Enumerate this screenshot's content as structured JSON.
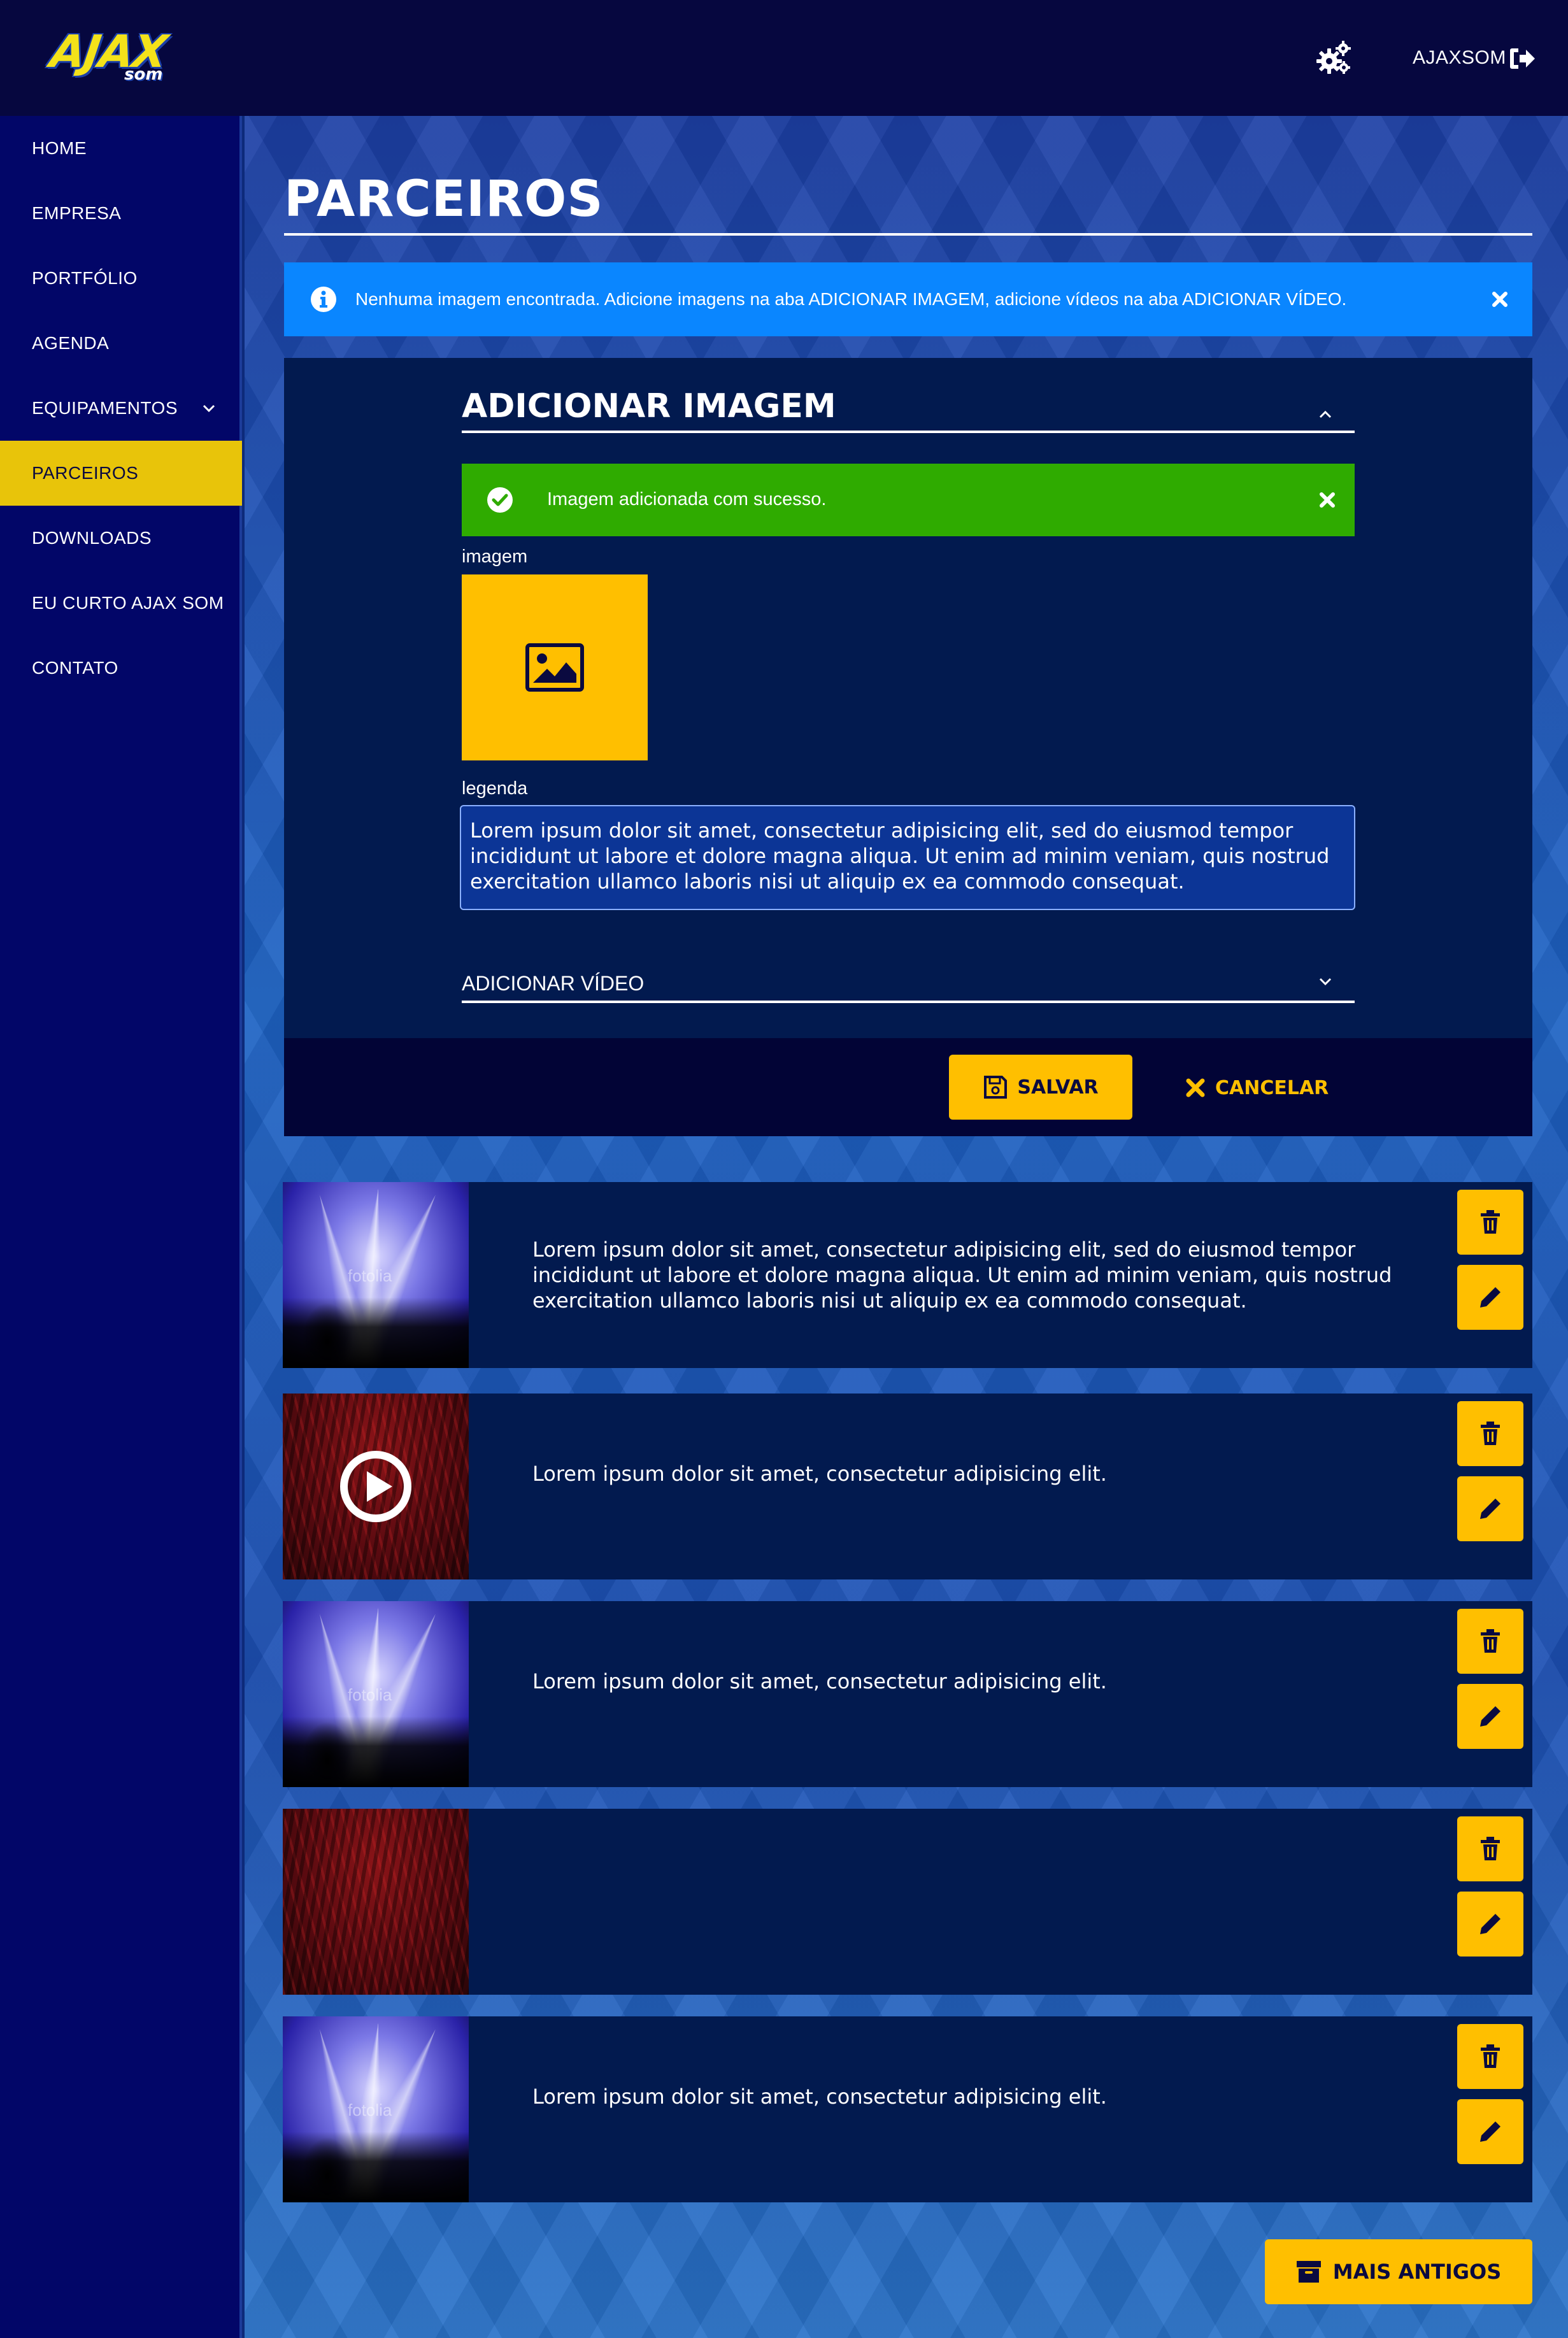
{
  "header": {
    "logo_text": "AJAX",
    "logo_subtext": "SOM",
    "settings_icon": "gears-icon",
    "user_name": "AJAXSOM",
    "logout_icon": "sign-out-icon"
  },
  "sidebar": {
    "items": [
      {
        "label": "HOME"
      },
      {
        "label": "EMPRESA"
      },
      {
        "label": "PORTFÓLIO"
      },
      {
        "label": "AGENDA"
      },
      {
        "label": "EQUIPAMENTOS",
        "has_submenu": true
      },
      {
        "label": "PARCEIROS",
        "active": true
      },
      {
        "label": "DOWNLOADS"
      },
      {
        "label": "EU CURTO AJAX SOM"
      },
      {
        "label": "CONTATO"
      }
    ]
  },
  "page": {
    "title": "PARCEIROS"
  },
  "info_alert": {
    "text": "Nenhuma imagem encontrada. Adicione imagens na aba ADICIONAR IMAGEM, adicione vídeos na aba ADICIONAR VÍDEO.",
    "icon": "info-circle-icon",
    "close_icon": "close-icon"
  },
  "form": {
    "section_title": "ADICIONAR IMAGEM",
    "success_text": "Imagem adicionada com sucesso.",
    "image_label": "imagem",
    "caption_label": "legenda",
    "caption_value": "Lorem ipsum dolor sit amet, consectetur adipisicing elit, sed do eiusmod tempor incididunt ut labore et dolore magna aliqua. Ut enim ad minim veniam, quis nostrud exercitation ullamco laboris nisi ut aliquip ex ea commodo consequat.",
    "video_section_title": "ADICIONAR VÍDEO",
    "save_label": "SALVAR",
    "cancel_label": "CANCELAR"
  },
  "list": {
    "items": [
      {
        "thumb": "concert-blue",
        "is_video": false,
        "caption": "Lorem ipsum dolor sit amet, consectetur adipisicing elit, sed do eiusmod tempor incididunt ut labore et dolore magna aliqua. Ut enim ad minim veniam, quis nostrud exercitation ullamco laboris nisi ut aliquip ex ea commodo consequat."
      },
      {
        "thumb": "concert-red",
        "is_video": true,
        "caption": "Lorem ipsum dolor sit amet, consectetur adipisicing elit."
      },
      {
        "thumb": "concert-blue",
        "is_video": false,
        "caption": "Lorem ipsum dolor sit amet, consectetur adipisicing elit."
      },
      {
        "thumb": "concert-red",
        "is_video": false,
        "caption": ""
      },
      {
        "thumb": "concert-blue",
        "is_video": false,
        "caption": "Lorem ipsum dolor sit amet, consectetur adipisicing elit."
      }
    ],
    "watermark": "fotolia",
    "more_label": "MAIS ANTIGOS"
  },
  "colors": {
    "accent": "#ffbf00",
    "nav_active": "#e8c40a",
    "info": "#0a86ff",
    "success": "#2fab00",
    "panel": "#021a4f",
    "sidebar": "#020668",
    "header": "#06073f"
  }
}
